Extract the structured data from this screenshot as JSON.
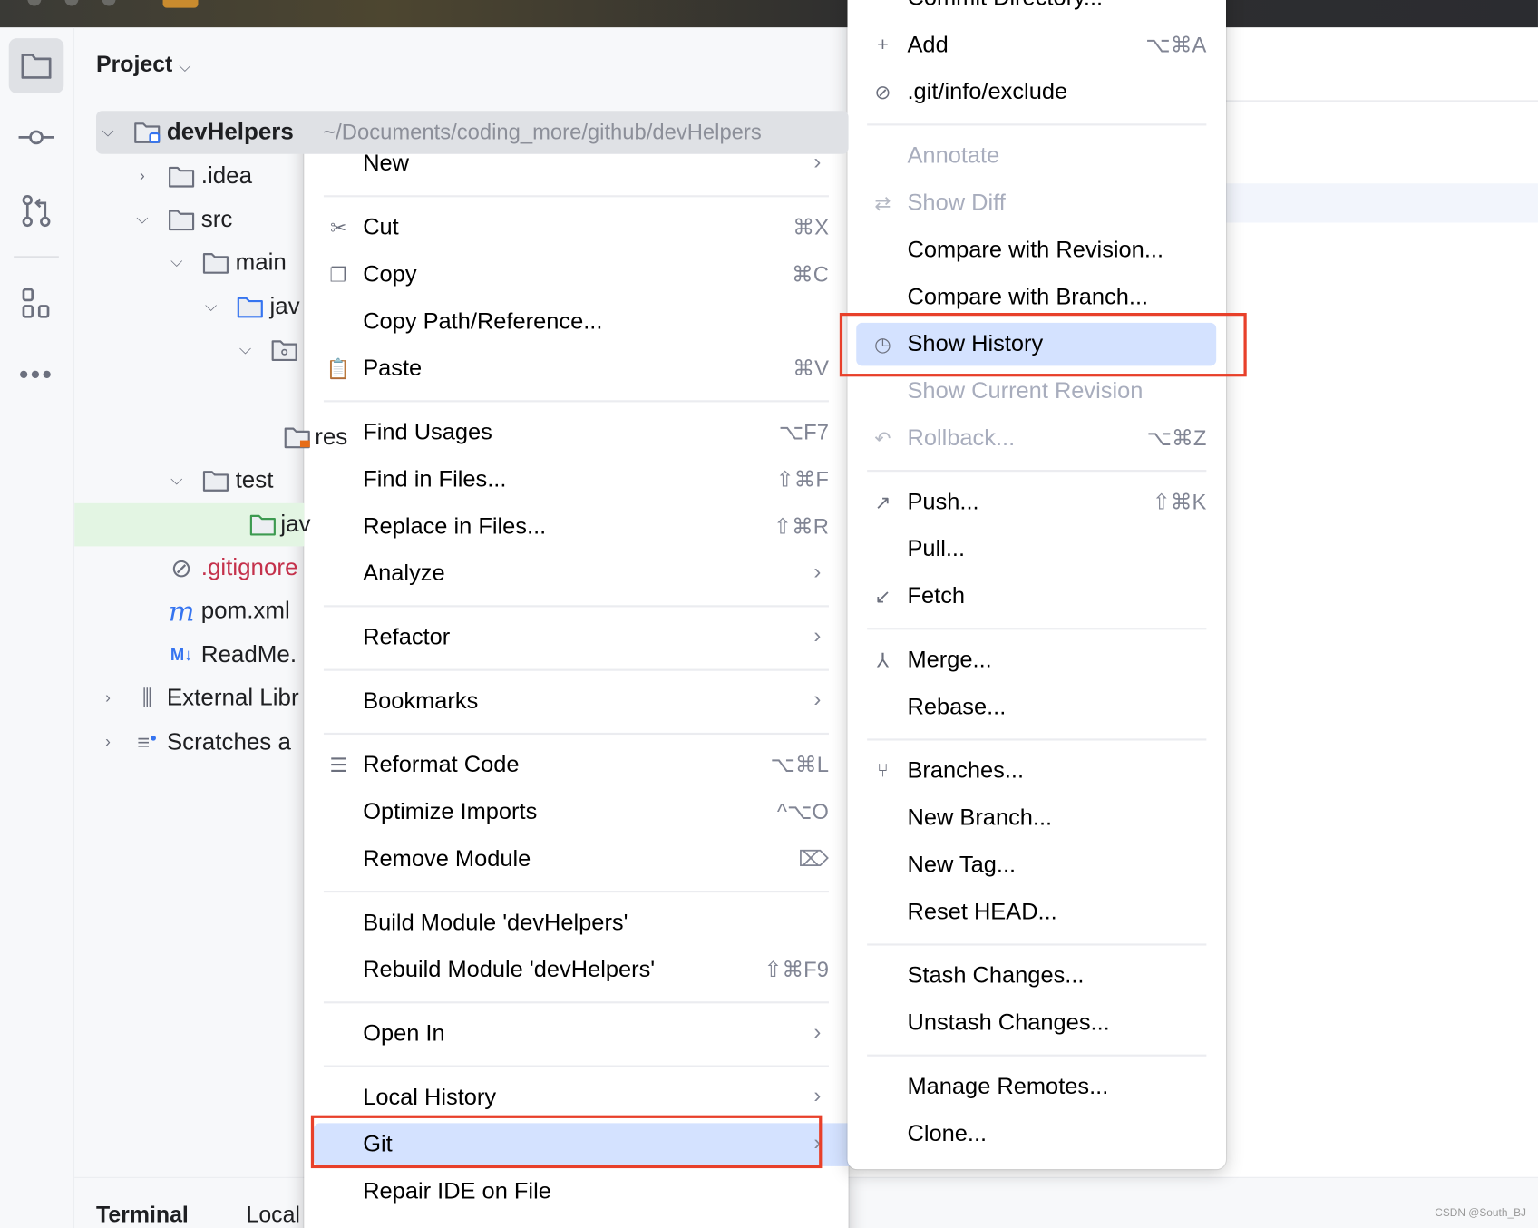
{
  "project_panel": {
    "title": "Project",
    "tree": [
      {
        "label": "devHelpers",
        "path": "~/Documents/coding_more/github/devHelpers",
        "expanded": true,
        "icon": "module-folder-icon",
        "selected": true
      },
      {
        "label": ".idea",
        "expanded": false,
        "icon": "folder-icon"
      },
      {
        "label": "src",
        "expanded": true,
        "icon": "folder-icon"
      },
      {
        "label": "main",
        "expanded": true,
        "icon": "folder-icon"
      },
      {
        "label": "jav",
        "expanded": true,
        "icon": "source-folder-icon"
      },
      {
        "label": "",
        "expanded": true,
        "icon": "package-icon"
      },
      {
        "label": "res",
        "icon": "resources-folder-icon"
      },
      {
        "label": "test",
        "expanded": true,
        "icon": "folder-icon"
      },
      {
        "label": "jav",
        "icon": "test-folder-icon"
      },
      {
        "label": ".gitignore",
        "icon": "ignored-file-icon",
        "color": "#c4314b"
      },
      {
        "label": "pom.xml",
        "icon": "maven-icon"
      },
      {
        "label": "ReadMe.",
        "icon": "markdown-icon"
      },
      {
        "label": "External Libr",
        "expanded": false,
        "icon": "libraries-icon"
      },
      {
        "label": "Scratches a",
        "expanded": false,
        "icon": "scratches-icon"
      }
    ]
  },
  "bottom_tabs": [
    "Terminal",
    "Local"
  ],
  "context_menu": {
    "items": [
      {
        "label": "New",
        "submenu": true
      },
      {
        "sep": true
      },
      {
        "label": "Cut",
        "icon": "scissors-icon",
        "shortcut": "⌘X"
      },
      {
        "label": "Copy",
        "icon": "copy-icon",
        "shortcut": "⌘C"
      },
      {
        "label": "Copy Path/Reference..."
      },
      {
        "label": "Paste",
        "icon": "paste-icon",
        "shortcut": "⌘V"
      },
      {
        "sep": true
      },
      {
        "label": "Find Usages",
        "shortcut": "⌥F7"
      },
      {
        "label": "Find in Files...",
        "shortcut": "⇧⌘F"
      },
      {
        "label": "Replace in Files...",
        "shortcut": "⇧⌘R"
      },
      {
        "label": "Analyze",
        "submenu": true
      },
      {
        "sep": true
      },
      {
        "label": "Refactor",
        "submenu": true
      },
      {
        "sep": true
      },
      {
        "label": "Bookmarks",
        "submenu": true
      },
      {
        "sep": true
      },
      {
        "label": "Reformat Code",
        "icon": "reformat-icon",
        "shortcut": "⌥⌘L"
      },
      {
        "label": "Optimize Imports",
        "shortcut": "^⌥O"
      },
      {
        "label": "Remove Module",
        "shortcut": "⌦"
      },
      {
        "sep": true
      },
      {
        "label": "Build Module 'devHelpers'"
      },
      {
        "label": "Rebuild Module 'devHelpers'",
        "shortcut": "⇧⌘F9"
      },
      {
        "sep": true
      },
      {
        "label": "Open In",
        "submenu": true
      },
      {
        "sep": true
      },
      {
        "label": "Local History",
        "submenu": true
      },
      {
        "label": "Git",
        "submenu": true,
        "selected": true
      },
      {
        "label": "Repair IDE on File"
      }
    ]
  },
  "git_menu": {
    "items": [
      {
        "label": "Commit Directory..."
      },
      {
        "label": "Add",
        "icon": "plus-icon",
        "shortcut": "⌥⌘A"
      },
      {
        "label": ".git/info/exclude",
        "icon": "ignore-icon"
      },
      {
        "sep": true
      },
      {
        "label": "Annotate",
        "disabled": true
      },
      {
        "label": "Show Diff",
        "icon": "diff-icon",
        "disabled": true
      },
      {
        "label": "Compare with Revision..."
      },
      {
        "label": "Compare with Branch..."
      },
      {
        "label": "Show History",
        "icon": "clock-icon",
        "selected": true
      },
      {
        "label": "Show Current Revision",
        "disabled": true
      },
      {
        "label": "Rollback...",
        "icon": "rollback-icon",
        "shortcut": "⌥⌘Z",
        "disabled": true
      },
      {
        "sep": true
      },
      {
        "label": "Push...",
        "icon": "push-icon",
        "shortcut": "⇧⌘K"
      },
      {
        "label": "Pull..."
      },
      {
        "label": "Fetch",
        "icon": "fetch-icon"
      },
      {
        "sep": true
      },
      {
        "label": "Merge...",
        "icon": "merge-icon"
      },
      {
        "label": "Rebase..."
      },
      {
        "sep": true
      },
      {
        "label": "Branches...",
        "icon": "branch-icon"
      },
      {
        "label": "New Branch..."
      },
      {
        "label": "New Tag..."
      },
      {
        "label": "Reset HEAD..."
      },
      {
        "sep": true
      },
      {
        "label": "Stash Changes..."
      },
      {
        "label": "Unstash Changes..."
      },
      {
        "sep": true
      },
      {
        "label": "Manage Remotes..."
      },
      {
        "label": "Clone..."
      }
    ]
  },
  "watermark": "CSDN @South_BJ",
  "colors": {
    "selection": "#d4e2ff",
    "highlight_box": "#e8402a",
    "test_row": "#e3f5e3"
  }
}
